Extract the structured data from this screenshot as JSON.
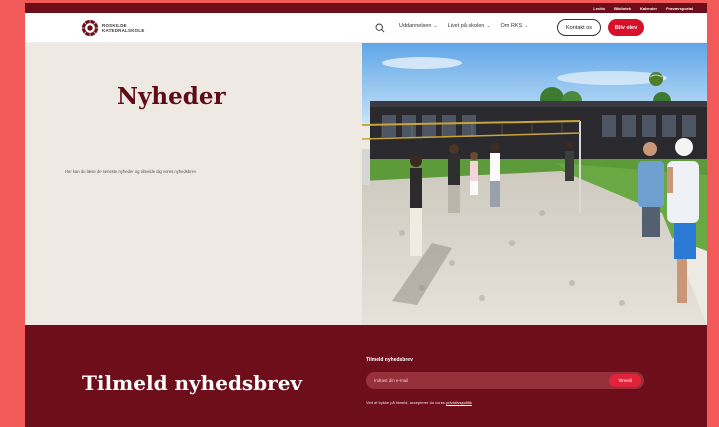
{
  "topbar": {
    "links": [
      "Lectio",
      "Bibliotek",
      "Kalender",
      "Fraværsportal"
    ]
  },
  "header": {
    "logo_line1": "ROSKILDE",
    "logo_line2": "KATEDRALSKOLE",
    "menu": [
      {
        "label": "Uddannelsen"
      },
      {
        "label": "Livet på skolen"
      },
      {
        "label": "Om RKS"
      }
    ],
    "contact_label": "Kontakt os",
    "cta_label": "Bliv elev"
  },
  "hero": {
    "title": "Nyheder",
    "subtitle": "Her kan du læse de seneste nyheder og tilmelde dig vores nyhedsbrev"
  },
  "newsletter": {
    "title": "Tilmeld nyhedsbrev",
    "label": "Tilmeld nyhedsbrev",
    "placeholder": "Indtast din e-mail",
    "submit": "Tilmeld",
    "consent_prefix": "Ved at trykke på tilmeld, accepterer du vores",
    "consent_link": "privatlivspolitik"
  },
  "colors": {
    "brand_dark": "#6e0e1a",
    "accent_red": "#d8112b",
    "background": "#efe9e3",
    "outer": "#f25a5a"
  }
}
